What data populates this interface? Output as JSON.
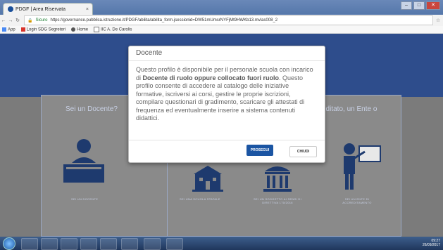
{
  "browser": {
    "tab_title": "PDGF | Area Riservata",
    "tab_close": "×",
    "secure_label": "Sicuro",
    "url": "https://governance.pubblica.istruzione.it/PDGF/abilita/abilita_form.jsessionid=DW51mUmsrNYFjMt9HWKb13.mvlas008_2",
    "bookmarks": [
      "App",
      "Login SDG Segreteri",
      "Home",
      "IIC A. De Carolis"
    ]
  },
  "window_controls": [
    "–",
    "□",
    "✕"
  ],
  "page": {
    "panel_left_title": "Sei un Docente?",
    "panel_right_title": "editato, un Ente o",
    "captions": {
      "docente": "SEI UN DOCENTE",
      "scuola": "SEI UNA SCUOLA STATALE",
      "soggetto": "SEI UN SOGGETTO AI SENSI DI DIRETTIVA 170/2016",
      "ente": "SEI UN ENTE DI ACCREDITAMENTO"
    }
  },
  "modal": {
    "title": "Docente",
    "text_1": "Questo profilo è disponibile per il personale scuola con incarico di ",
    "text_bold": "Docente di ruolo oppure collocato fuori ruolo",
    "text_2": ". Questo profilo consente di accedere al catalogo delle iniziative formative, iscriversi ai corsi, gestire le proprie iscrizioni, compilare questionari di gradimento, scaricare gli attestati di frequenza ed eventualmente inserire a sistema contenuti didattici.",
    "primary_button": "PROSEGUI",
    "secondary_button": "CHIUDI"
  },
  "taskbar": {
    "time": "09:27",
    "date": "26/09/2017"
  },
  "colors": {
    "header_blue": "#2e4d8c",
    "primary": "#1b55a3"
  }
}
